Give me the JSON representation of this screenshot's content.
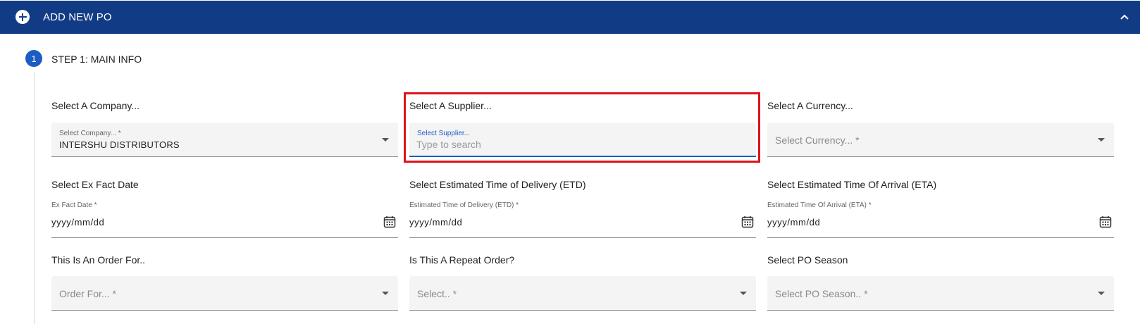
{
  "header": {
    "title": "ADD NEW PO",
    "add_icon": "plus-circle-icon",
    "collapse_icon": "chevron-up-icon",
    "color": "#123b86"
  },
  "step": {
    "number": "1",
    "title": "STEP 1: MAIN INFO",
    "accent": "#1c5cc5"
  },
  "fields": {
    "company": {
      "label": "Select A Company...",
      "float_label": "Select Company... *",
      "value": "INTERSHU DISTRIBUTORS"
    },
    "supplier": {
      "label": "Select A Supplier...",
      "float_label": "Select Supplier...",
      "placeholder": "Type to search"
    },
    "currency": {
      "label": "Select A Currency...",
      "placeholder": "Select Currency... *"
    },
    "ex_fact_date": {
      "label": "Select Ex Fact Date",
      "float_label": "Ex Fact Date *",
      "value": "yyyy/mm/dd"
    },
    "etd": {
      "label": "Select Estimated Time of Delivery (ETD)",
      "float_label": "Estimated Time of Delivery (ETD) *",
      "value": "yyyy/mm/dd"
    },
    "eta": {
      "label": "Select Estimated Time Of Arrival (ETA)",
      "float_label": "Estimated Time Of Arrival (ETA) *",
      "value": "yyyy/mm/dd"
    },
    "order_for": {
      "label": "This Is An Order For..",
      "placeholder": "Order For... *"
    },
    "repeat_order": {
      "label": "Is This A Repeat Order?",
      "placeholder": "Select.. *"
    },
    "po_season": {
      "label": "Select PO Season",
      "placeholder": "Select PO Season.. *"
    }
  },
  "highlight_color": "#e0121c"
}
